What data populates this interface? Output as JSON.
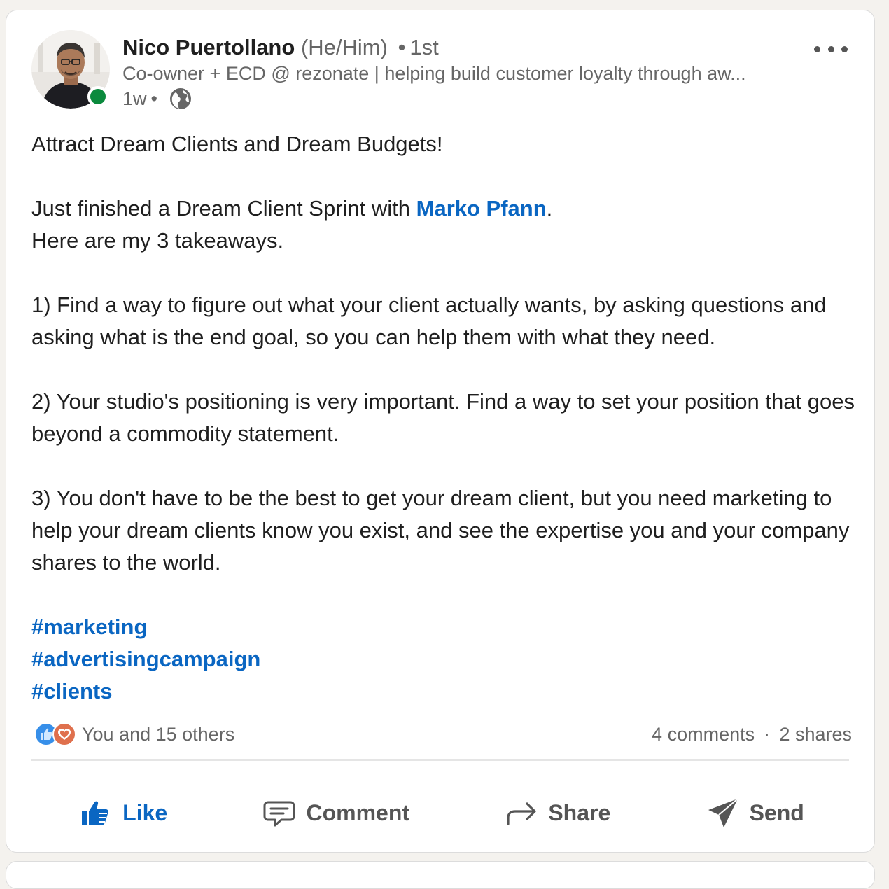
{
  "author": {
    "name": "Nico Puertollano",
    "pronouns": "(He/Him)",
    "connection_degree": "1st",
    "headline": "Co-owner + ECD @ rezonate | helping build customer loyalty through aw...",
    "posted_time": "1w",
    "visibility_icon": "globe-icon",
    "online_status_color": "#0b8a3d"
  },
  "post": {
    "title_line": "Attract Dream Clients and Dream Budgets!",
    "intro_before_mention": "Just finished a Dream Client Sprint with ",
    "mention": "Marko Pfann",
    "intro_after_mention": ".",
    "intro_line2": "Here are my 3 takeaways.",
    "takeaway_1": "1) Find a way to figure out what your client actually wants, by asking questions and asking what is the end goal, so you can help them with what they need.",
    "takeaway_2": "2) Your studio's positioning is very important. Find a way to set your position that goes beyond a commodity statement.",
    "takeaway_3": "3) You don't have to be the best to get your dream client, but you need marketing to help your dream clients know you exist, and see the expertise you and your company shares to the world.",
    "hashtags": [
      "#marketing",
      "#advertisingcampaign",
      "#clients"
    ]
  },
  "social": {
    "reaction_icons": [
      "like-reaction-icon",
      "love-reaction-icon"
    ],
    "reactions_text": "You and 15 others",
    "comments": "4 comments",
    "separator": "·",
    "shares": "2 shares"
  },
  "actions": {
    "like": "Like",
    "comment": "Comment",
    "share": "Share",
    "send": "Send"
  },
  "colors": {
    "link_blue": "#0a66c2",
    "muted_text": "#666666",
    "love_reaction": "#df704d",
    "like_reaction": "#378fe9"
  }
}
